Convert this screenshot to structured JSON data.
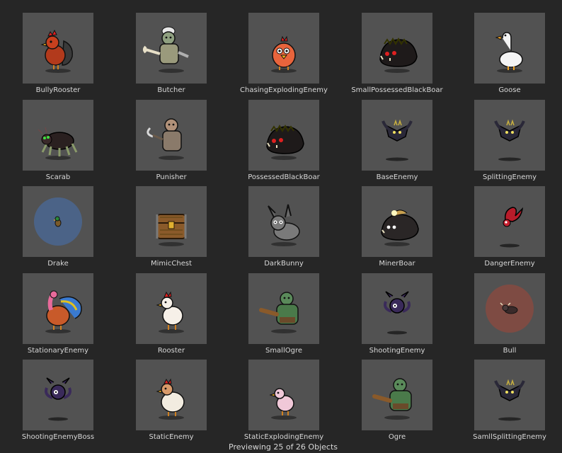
{
  "grid": {
    "items": [
      {
        "label": "BullyRooster",
        "icon": "rooster-icon"
      },
      {
        "label": "Butcher",
        "icon": "butcher-icon"
      },
      {
        "label": "ChasingExplodingEnemy",
        "icon": "red-bird-icon"
      },
      {
        "label": "SmallPossessedBlackBoar",
        "icon": "black-boar-icon"
      },
      {
        "label": "Goose",
        "icon": "goose-icon"
      },
      {
        "label": "Scarab",
        "icon": "scarab-icon"
      },
      {
        "label": "Punisher",
        "icon": "punisher-icon"
      },
      {
        "label": "PossessedBlackBoar",
        "icon": "black-boar-icon"
      },
      {
        "label": "BaseEnemy",
        "icon": "bat-icon"
      },
      {
        "label": "SplittingEnemy",
        "icon": "bat-icon"
      },
      {
        "label": "Drake",
        "icon": "drake-icon"
      },
      {
        "label": "MimicChest",
        "icon": "chest-icon"
      },
      {
        "label": "DarkBunny",
        "icon": "bunny-icon"
      },
      {
        "label": "MinerBoar",
        "icon": "miner-boar-icon"
      },
      {
        "label": "DangerEnemy",
        "icon": "red-bat-icon"
      },
      {
        "label": "StationaryEnemy",
        "icon": "turkey-icon"
      },
      {
        "label": "Rooster",
        "icon": "chicken-icon"
      },
      {
        "label": "SmallOgre",
        "icon": "ogre-icon"
      },
      {
        "label": "ShootingEnemy",
        "icon": "purple-bat-icon"
      },
      {
        "label": "Bull",
        "icon": "bull-icon"
      },
      {
        "label": "ShootingEnemyBoss",
        "icon": "purple-bat-icon"
      },
      {
        "label": "StaticEnemy",
        "icon": "hen-icon"
      },
      {
        "label": "StaticExplodingEnemy",
        "icon": "pink-bird-icon"
      },
      {
        "label": "Ogre",
        "icon": "ogre-icon"
      },
      {
        "label": "SamllSplittingEnemy",
        "icon": "bat-icon"
      }
    ]
  },
  "status": {
    "text": "Previewing 25 of 26 Objects"
  }
}
